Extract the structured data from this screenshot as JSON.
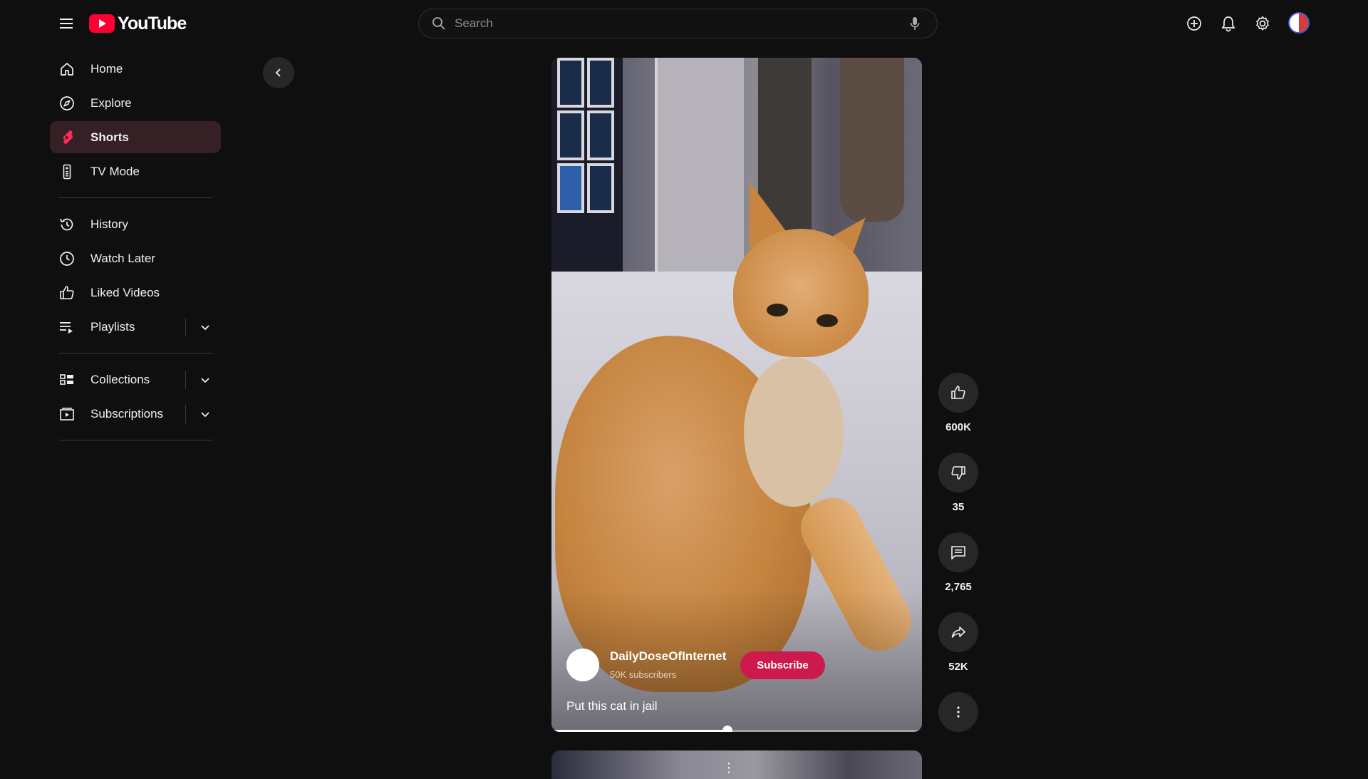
{
  "header": {
    "logo_text": "YouTube",
    "search_placeholder": "Search"
  },
  "sidebar": {
    "items": [
      {
        "label": "Home",
        "icon": "home-icon"
      },
      {
        "label": "Explore",
        "icon": "compass-icon"
      },
      {
        "label": "Shorts",
        "icon": "shorts-icon",
        "active": true
      },
      {
        "label": "TV Mode",
        "icon": "remote-icon"
      },
      {
        "label": "History",
        "icon": "history-icon"
      },
      {
        "label": "Watch Later",
        "icon": "clock-icon"
      },
      {
        "label": "Liked Videos",
        "icon": "thumb-up-icon"
      },
      {
        "label": "Playlists",
        "icon": "playlist-icon",
        "expandable": true
      },
      {
        "label": "Collections",
        "icon": "collections-icon",
        "expandable": true
      },
      {
        "label": "Subscriptions",
        "icon": "subscriptions-icon",
        "expandable": true
      }
    ]
  },
  "short": {
    "channel_name": "DailyDoseOfInternet",
    "subscribers": "50K subscribers",
    "subscribe_label": "Subscribe",
    "caption": "Put this cat in jail",
    "progress": 0.475
  },
  "actions": {
    "likes": "600K",
    "dislikes": "35",
    "comments": "2,765",
    "shares": "52K"
  },
  "colors": {
    "background": "#0f0f0f",
    "accent": "#cc1a4c",
    "active_nav": "#352025",
    "button_bg": "#272727"
  }
}
